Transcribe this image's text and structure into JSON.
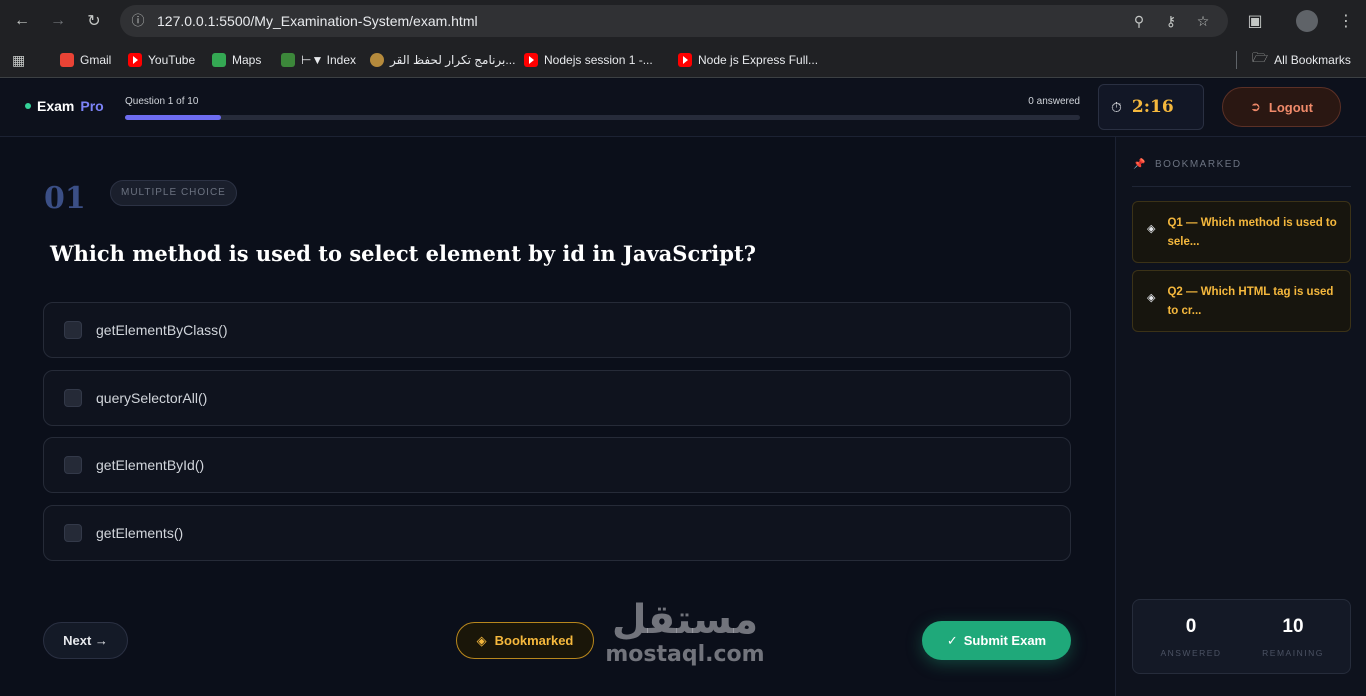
{
  "browser": {
    "url": "127.0.0.1:5500/My_Examination-System/exam.html",
    "bookmarks": [
      {
        "label": "Gmail",
        "icon": "gmail-icon"
      },
      {
        "label": "YouTube",
        "icon": "youtube-icon"
      },
      {
        "label": "Maps",
        "icon": "maps-icon"
      },
      {
        "label": "⊢▼ Index",
        "icon": "node-icon"
      },
      {
        "label": "برنامج تكرار لحفظ القر...",
        "icon": "quran-icon"
      },
      {
        "label": "Nodejs session 1 -...",
        "icon": "youtube-icon"
      },
      {
        "label": "Node js Express Full...",
        "icon": "youtube-icon"
      }
    ],
    "all_bookmarks_label": "All Bookmarks"
  },
  "header": {
    "brand_exam": "Exam",
    "brand_pro": "Pro",
    "progress_label": "Question 1 of 10",
    "progress_fraction": 0.1,
    "answered_label": "0 answered",
    "timer": "2:16",
    "logout_label": "Logout"
  },
  "question": {
    "number": "01",
    "type": "MULTIPLE CHOICE",
    "text": "Which method is used to select element by id in JavaScript?",
    "options": [
      "getElementByClass()",
      "querySelectorAll()",
      "getElementById()",
      "getElements()"
    ]
  },
  "actions": {
    "next_label": "Next →",
    "bookmark_label": "Bookmarked",
    "submit_label": "Submit Exam"
  },
  "sidebar": {
    "title": "BOOKMARKED",
    "bookmarks": [
      {
        "text": "Q1 — Which method is used to sele..."
      },
      {
        "text": "Q2 — Which HTML tag is used to cr..."
      }
    ],
    "answered_value": "0",
    "answered_label": "ANSWERED",
    "remaining_value": "10",
    "remaining_label": "REMAINING"
  },
  "watermark": {
    "arabic": "مستقل",
    "latin": "mostaql.com"
  },
  "colors": {
    "accent": "#6d6cf0",
    "timer": "#f5b83d",
    "submit": "#1fa97a",
    "logout": "#f08a6a",
    "background": "#0b0f1a"
  }
}
